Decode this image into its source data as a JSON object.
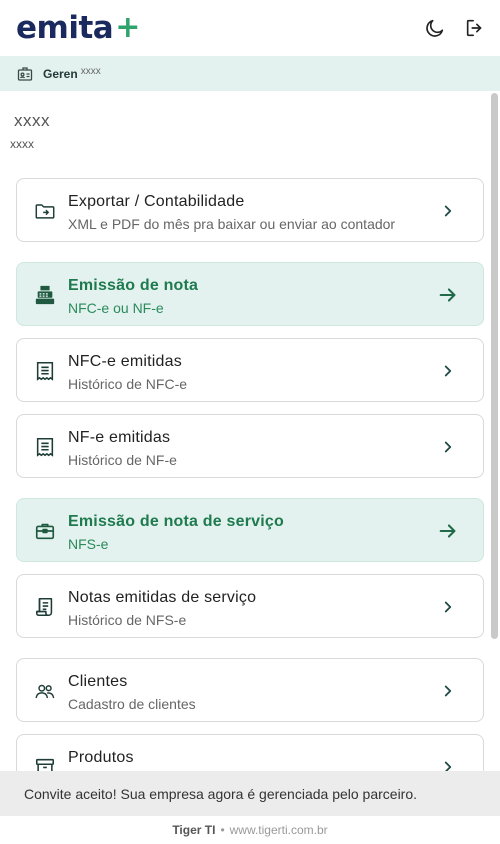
{
  "header": {
    "logo_text": "emita",
    "logo_plus": "+",
    "theme_icon": "moon-icon",
    "logout_icon": "logout-icon"
  },
  "rolebar": {
    "icon": "id-badge-icon",
    "label": "Geren",
    "name": "xxxx"
  },
  "company": {
    "name": "xxxx",
    "sub": "xxxx"
  },
  "menu": [
    {
      "title": "Exportar / Contabilidade",
      "subtitle": "XML e PDF do mês pra baixar ou enviar ao contador",
      "icon": "folder-export-icon",
      "highlight": false
    },
    {
      "title": "Emissão de nota",
      "subtitle": "NFC-e ou NF-e",
      "icon": "cash-register-icon",
      "highlight": true
    },
    {
      "title": "NFC-e emitidas",
      "subtitle": "Histórico de NFC-e",
      "icon": "receipt-list-icon",
      "highlight": false
    },
    {
      "title": "NF-e emitidas",
      "subtitle": "Histórico de NF-e",
      "icon": "receipt-list-icon",
      "highlight": false
    },
    {
      "title": "Emissão de nota de serviço",
      "subtitle": "NFS-e",
      "icon": "briefcase-icon",
      "highlight": true
    },
    {
      "title": "Notas emitidas de serviço",
      "subtitle": "Histórico de NFS-e",
      "icon": "document-icon",
      "highlight": false
    },
    {
      "title": "Clientes",
      "subtitle": "Cadastro de clientes",
      "icon": "users-icon",
      "highlight": false
    },
    {
      "title": "Produtos",
      "subtitle": "",
      "icon": "box-icon",
      "highlight": false
    }
  ],
  "toast": {
    "message": "Convite aceito! Sua empresa agora é gerenciada pelo parceiro."
  },
  "footer": {
    "brand": "Tiger TI",
    "separator": "•",
    "url": "www.tigerti.com.br"
  },
  "colors": {
    "brand_navy": "#1b2a5e",
    "brand_green": "#2ea36b",
    "highlight_bg": "#e3f2ee",
    "highlight_text": "#1f7a4f"
  }
}
